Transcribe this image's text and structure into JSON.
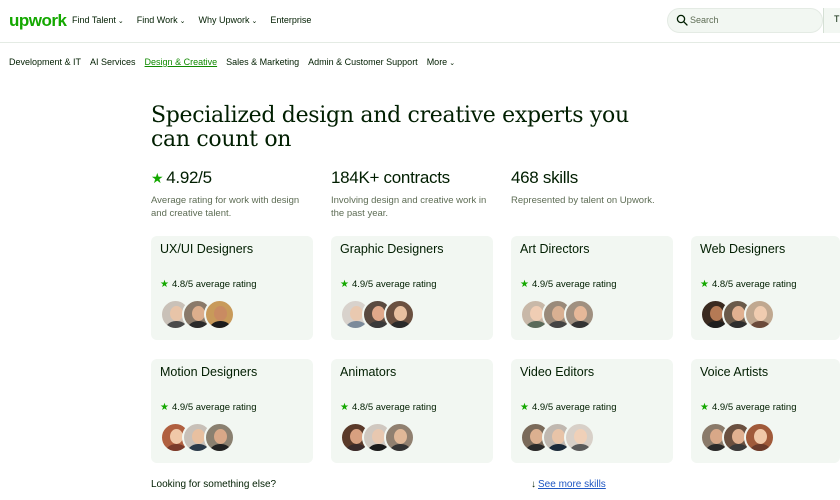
{
  "header": {
    "logo": "upwork",
    "nav": [
      {
        "label": "Find Talent",
        "chevron": "⌄"
      },
      {
        "label": "Find Work",
        "chevron": "⌄"
      },
      {
        "label": "Why Upwork",
        "chevron": "⌄"
      },
      {
        "label": "Enterprise",
        "chevron": ""
      }
    ],
    "search_placeholder": "Search",
    "search_option": "T"
  },
  "categories": {
    "items": [
      "Development & IT",
      "AI Services",
      "Design & Creative",
      "Sales & Marketing",
      "Admin & Customer Support",
      "More"
    ],
    "active_index": 2,
    "more_chevron": "⌄"
  },
  "hero": {
    "title": "Specialized design and creative experts you can count on"
  },
  "stats": [
    {
      "value": "4.92/5",
      "star": "★",
      "desc": "Average rating for work with design and creative talent."
    },
    {
      "value": "184K+ contracts",
      "desc": "Involving design and creative work in the past year."
    },
    {
      "value": "468 skills",
      "desc": "Represented by talent on Upwork."
    }
  ],
  "cards": [
    {
      "title": "UX/UI Designers",
      "rating": "4.8/5 average rating"
    },
    {
      "title": "Graphic Designers",
      "rating": "4.9/5 average rating"
    },
    {
      "title": "Art Directors",
      "rating": "4.9/5 average rating"
    },
    {
      "title": "Web Designers",
      "rating": "4.8/5 average rating"
    },
    {
      "title": "Motion Designers",
      "rating": "4.9/5 average rating"
    },
    {
      "title": "Animators",
      "rating": "4.8/5 average rating"
    },
    {
      "title": "Video Editors",
      "rating": "4.9/5 average rating"
    },
    {
      "title": "Voice Artists",
      "rating": "4.9/5 average rating"
    }
  ],
  "footer": {
    "prompt": "Looking for something else?",
    "arrow": "↓",
    "link": "See more skills"
  },
  "colors": {
    "brand_green": "#14a800",
    "card_bg": "#f2f7f2",
    "link_blue": "#1f57c3",
    "text_dark": "#001e00",
    "text_muted": "#5e6d55"
  },
  "icons": {
    "search": "search-icon",
    "star": "star-icon",
    "chevron": "chevron-down-icon",
    "arrow_down": "arrow-down-icon"
  }
}
